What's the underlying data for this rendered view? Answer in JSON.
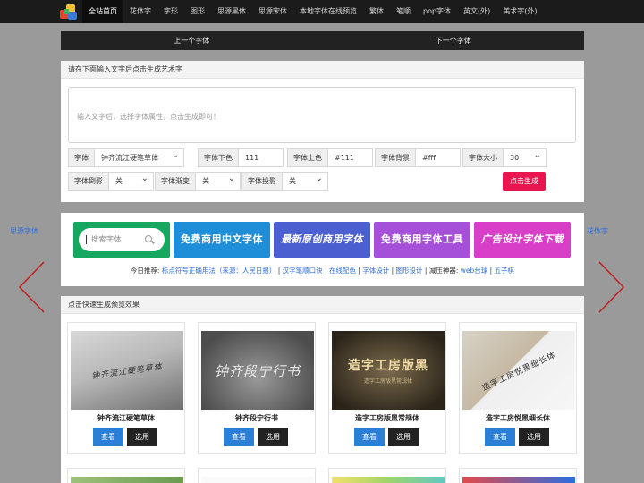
{
  "nav": {
    "items": [
      {
        "label": "全站首页",
        "active": true
      },
      {
        "label": "花体字"
      },
      {
        "label": "字形"
      },
      {
        "label": "图形"
      },
      {
        "label": "思源黑体"
      },
      {
        "label": "思源宋体"
      },
      {
        "label": "本地字体在线预览"
      },
      {
        "label": "繁体"
      },
      {
        "label": "笔顺"
      },
      {
        "label": "pop字体"
      },
      {
        "label": "英文(外)"
      },
      {
        "label": "美术字(外)"
      }
    ]
  },
  "pager": {
    "prev": "上一个字体",
    "next": "下一个字体"
  },
  "generator": {
    "heading": "请在下面输入文字后点击生成艺术字",
    "placeholder": "输入文字后，选择字体属性，点击生成即可！",
    "controls": {
      "font": {
        "label": "字体",
        "value": "钟齐流江硬笔草体"
      },
      "bottom_color": {
        "label": "字体下色",
        "value": "111"
      },
      "top_color": {
        "label": "字体上色",
        "value": "#111"
      },
      "background": {
        "label": "字体背景",
        "value": "#fff"
      },
      "size": {
        "label": "字体大小",
        "value": "30"
      },
      "shadow": {
        "label": "字体倒影",
        "value": "关"
      },
      "gradient": {
        "label": "字体渐变",
        "value": "关"
      },
      "projection": {
        "label": "字体投影",
        "value": "关"
      }
    },
    "generate_label": "点击生成"
  },
  "side": {
    "left": "思源字体",
    "right": "花体字"
  },
  "banners": {
    "search_placeholder": "搜索字体",
    "b2": "免费商用中文字体",
    "b3": "最新原创商用字体",
    "b4": "免费商用字体工具",
    "b5": "广告设计字体下载"
  },
  "recommend": {
    "prefix": "今日推荐:",
    "links": [
      "标点符号正确用法（来源：人民日报）",
      "汉字笔顺口诀",
      "在线配色",
      "字体设计",
      "图形设计"
    ],
    "mid": "减压神器:",
    "links2": [
      "web台球",
      "五子棋"
    ]
  },
  "preview": {
    "heading": "点击快速生成预览效果",
    "view_label": "查看",
    "pick_label": "选用",
    "cards": [
      {
        "name": "钟齐流江硬笔草体",
        "sample": "钟齐流江硬笔草体"
      },
      {
        "name": "钟齐段宁行书",
        "sample": "钟齐段宁行书"
      },
      {
        "name": "造字工房版黑常规体",
        "sample": "造字工房版黑",
        "sub": "造字工房版黑常规体"
      },
      {
        "name": "造字工房悦黑细长体",
        "sample": "造字工房悦黑细长体"
      }
    ]
  },
  "colors": {
    "accent": "#e8154f",
    "link": "#2f6fdc",
    "view": "#2b7fd6",
    "nav": "#1b1b1b"
  }
}
